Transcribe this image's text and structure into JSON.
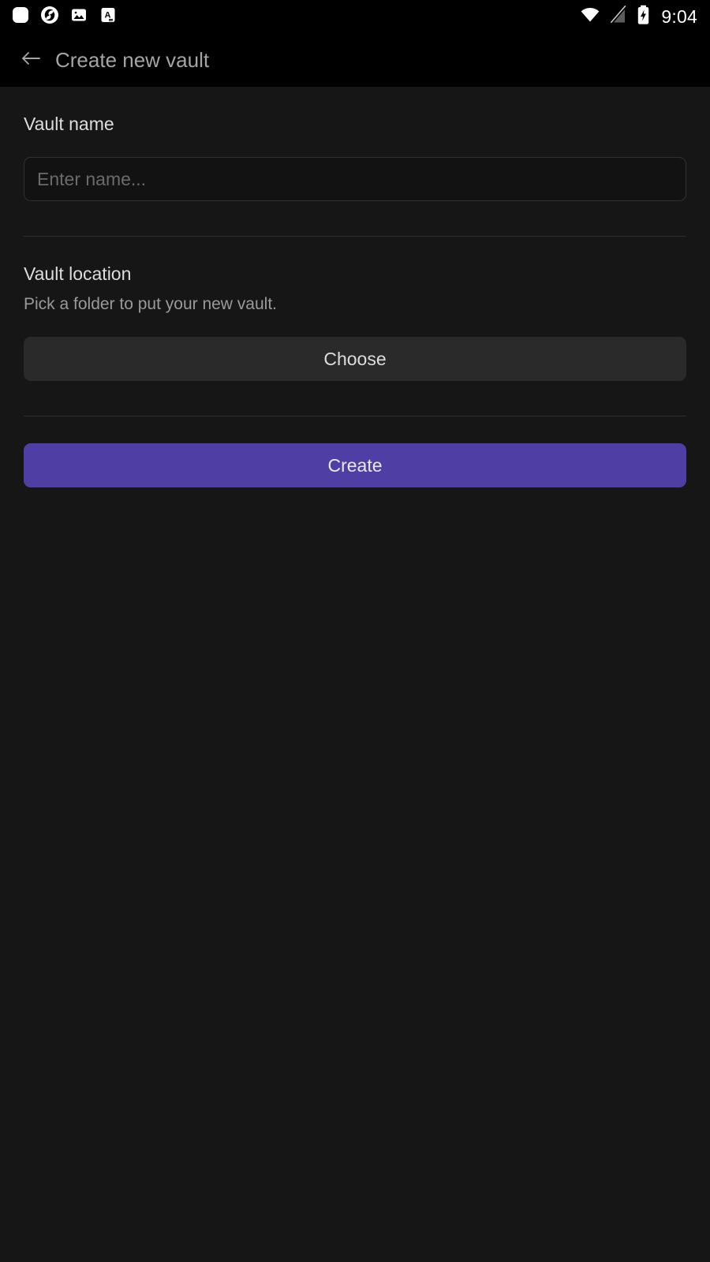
{
  "status_bar": {
    "icons_left": [
      {
        "name": "rounded-square-icon"
      },
      {
        "name": "obsidian-icon"
      },
      {
        "name": "image-icon"
      },
      {
        "name": "font-a-icon"
      }
    ],
    "icons_right": [
      {
        "name": "wifi-icon"
      },
      {
        "name": "no-cellular-signal-icon"
      },
      {
        "name": "battery-charging-icon"
      }
    ],
    "time": "9:04"
  },
  "toolbar": {
    "back_icon": "arrow-left-icon",
    "title": "Create new vault"
  },
  "vault_name": {
    "label": "Vault name",
    "placeholder": "Enter name...",
    "value": ""
  },
  "vault_location": {
    "label": "Vault location",
    "description": "Pick a folder to put your new vault.",
    "choose_label": "Choose"
  },
  "actions": {
    "create_label": "Create"
  },
  "colors": {
    "background": "#161616",
    "bar_background": "#000000",
    "accent": "#4f3fa4",
    "secondary_button": "#2a2a2a",
    "divider": "#2e2e2e",
    "label_text": "#dcddde",
    "muted_text": "#9a9a9a"
  }
}
